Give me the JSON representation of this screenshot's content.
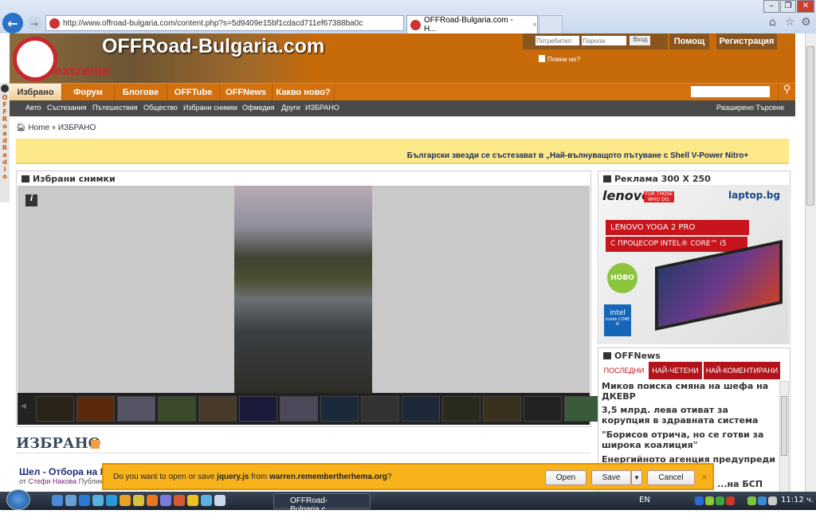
{
  "browser": {
    "url": "http://www.offroad-bulgaria.com/content.php?s=5d9409e15bf1cdacd711ef67388ba0c",
    "tab_title": "OFFRoad-Bulgaria.com - H...",
    "tab_close": "×"
  },
  "site": {
    "logo_text": "OFFRoad-Bulgaria.com",
    "logo_sub": "extreme",
    "login": {
      "user_placeholder": "Потребител",
      "pass_placeholder": "Парола",
      "login_button": "Вход",
      "remember": "Помни ме?"
    },
    "help": "Помощ",
    "register": "Регистрация",
    "nav": [
      "Избрано",
      "Форум",
      "Блогове",
      "OFFTube",
      "OFFNews",
      "Какво ново?"
    ],
    "subnav": [
      "Авто",
      "Състезания",
      "Пътешествия",
      "Общество",
      "Избрани снимки",
      "Офмедия",
      "Други",
      "ИЗБРАНО"
    ],
    "advanced_search": "Разширено Търсене",
    "radio": "OFFRoadRadio"
  },
  "breadcrumb": {
    "home": "Home",
    "current": "ИЗБРАНО"
  },
  "banner": "Български звезди се състезават в „Най-вълнуващото пътуване с Shell V-Power Nitro+",
  "gallery": {
    "title": "Избрани снимки",
    "info": "i",
    "prev": "◀",
    "next": "▶"
  },
  "section": {
    "title": "ИЗБРАНО",
    "article_title": "Шел - Отбора на М",
    "article_by": "от",
    "article_author": "Стефи Накова",
    "article_rest": "Публику"
  },
  "ad": {
    "title": "Реклама 300 X 250",
    "brand": "lenovo",
    "slogan": "FOR THOSE WHO DO.",
    "shop": "laptop.bg",
    "line1": "LENOVO YOGA 2 PRO",
    "line2": "С ПРОЦЕСОР INTEL® CORE™ i5",
    "badge": "НОВО",
    "intel": "intel",
    "intel_sub": "inside CORE i5"
  },
  "news": {
    "title": "OFFNews",
    "tabs": [
      "ПОСЛЕДНИ",
      "НАЙ-ЧЕТЕНИ",
      "НАЙ-КОМЕНТИРАНИ"
    ],
    "items": [
      "Миков поиска смяна на шефа на ДКЕВР",
      "3,5 млрд. лева отиват за корупция в здравната система",
      "\"Борисов отрича, но се готви за широка коалиция\"",
      "Енергийното агенция предупреди за ...ки...",
      "...на БСП"
    ]
  },
  "download": {
    "prefix": "Do you want to open or save ",
    "file": "jquery.js",
    "mid": " from ",
    "host": "warren.remembertherhema.org",
    "suffix": "?",
    "open": "Open",
    "save": "Save",
    "cancel": "Cancel",
    "close": "×"
  },
  "taskbar": {
    "task": "OFFRoad-Bulgaria.c...",
    "lang": "EN",
    "clock": "11:12 ч."
  }
}
